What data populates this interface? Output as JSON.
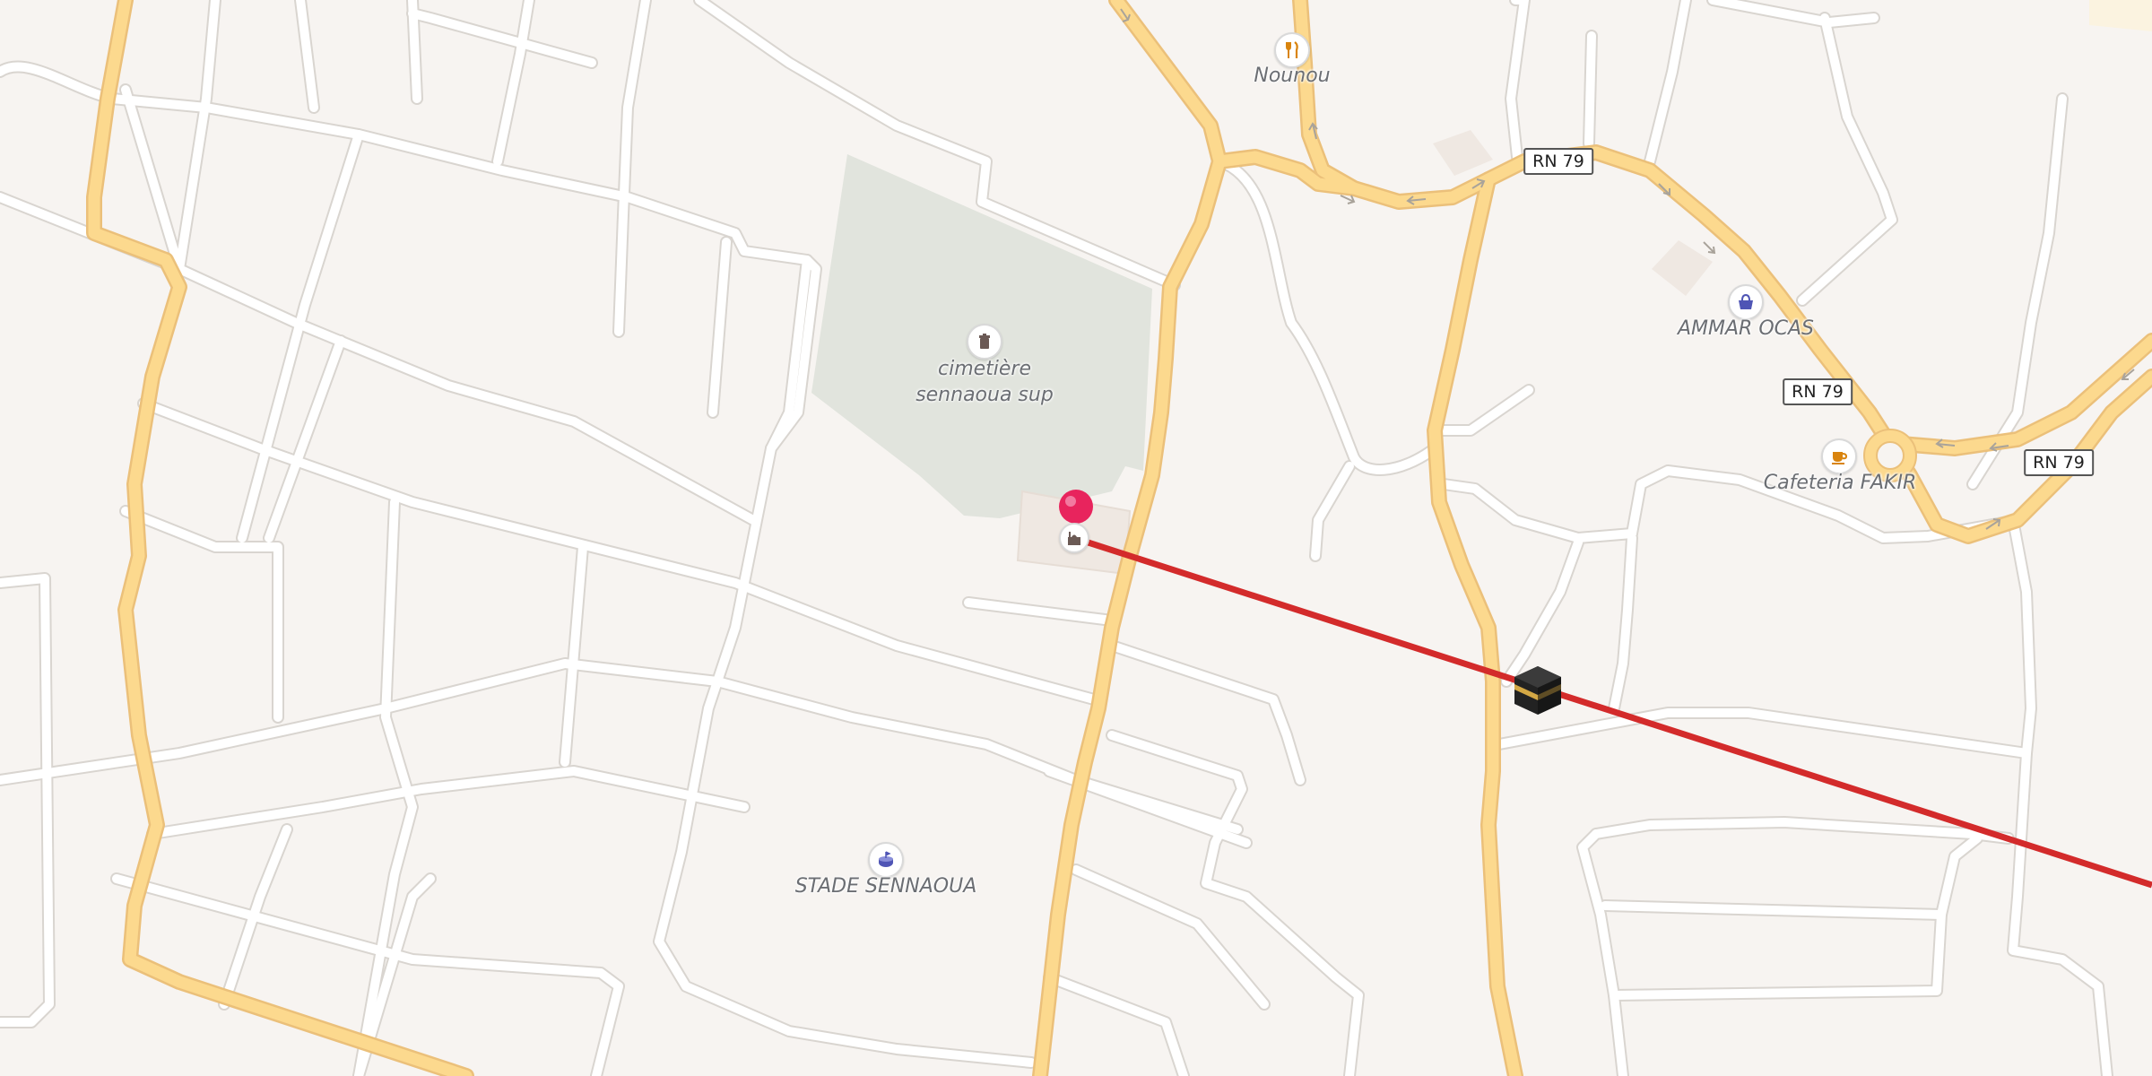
{
  "map": {
    "colors": {
      "background": "#f7f4f1",
      "minor_road": "#ffffff",
      "road_casing": "#dcd8d3",
      "major_road": "#fcd98e",
      "major_road_casing": "#ebc07a",
      "cemetery": "#e1e4dd",
      "building": "#efe8e2",
      "qibla_line": "#d32b2b",
      "pin": "#e8245d"
    },
    "road_labels": [
      "RN 79",
      "RN 79",
      "RN 79"
    ],
    "pois": [
      {
        "name": "Nounou",
        "icon": "restaurant-icon"
      },
      {
        "name": "AMMAR OCAS",
        "icon": "shopping-basket-icon"
      },
      {
        "name": "Cafeteria FAKIR",
        "icon": "cafe-icon"
      },
      {
        "name": "cimetière sennaoua sup",
        "line1": "cimetière",
        "line2": "sennaoua sup",
        "icon": "cemetery-icon"
      },
      {
        "name": "STADE SENNAOUA",
        "icon": "stadium-icon"
      }
    ],
    "markers": {
      "location_pin": "location-pin-icon",
      "mosque": "mosque-icon",
      "kaaba": "kaaba-icon"
    }
  }
}
